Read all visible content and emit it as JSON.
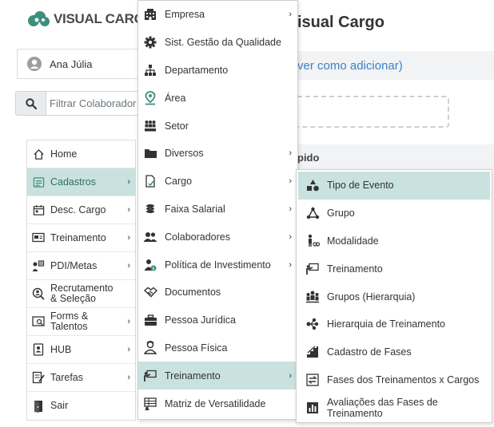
{
  "app": {
    "logo_text": "VISUAL CARGO",
    "page_title": "isual Cargo",
    "info_text": "ver como adicionar)",
    "section_text": "pido",
    "brand_color": "#3d8f7e",
    "active_color": "#c9e2df"
  },
  "user": {
    "name": "Ana Júlia"
  },
  "search": {
    "placeholder": "Filtrar Colaborador"
  },
  "sidebar": {
    "items": [
      {
        "label": "Home",
        "icon": "home-icon"
      },
      {
        "label": "Cadastros",
        "icon": "list-icon",
        "active": true
      },
      {
        "label": "Desc. Cargo",
        "icon": "calendar-icon"
      },
      {
        "label": "Treinamento",
        "icon": "presentation-icon"
      },
      {
        "label": "PDI/Metas",
        "icon": "goals-icon"
      },
      {
        "label": "Recrutamento & Seleção",
        "icon": "recruit-icon"
      },
      {
        "label": "Forms & Talentos",
        "icon": "form-icon"
      },
      {
        "label": "HUB",
        "icon": "hub-icon"
      },
      {
        "label": "Tarefas",
        "icon": "tasks-icon"
      },
      {
        "label": "Sair",
        "icon": "exit-icon"
      }
    ]
  },
  "menu_cadastros": {
    "items": [
      {
        "label": "Empresa",
        "icon": "building-icon"
      },
      {
        "label": "Sist. Gestão da Qualidade",
        "icon": "cog-icon"
      },
      {
        "label": "Departamento",
        "icon": "hierarchy-icon"
      },
      {
        "label": "Área",
        "icon": "map-pin-icon"
      },
      {
        "label": "Setor",
        "icon": "sector-icon"
      },
      {
        "label": "Diversos",
        "icon": "folder-icon"
      },
      {
        "label": "Cargo",
        "icon": "document-icon"
      },
      {
        "label": "Faixa Salarial",
        "icon": "coins-icon"
      },
      {
        "label": "Colaboradores",
        "icon": "users-icon"
      },
      {
        "label": "Política de Investimento",
        "icon": "investment-icon"
      },
      {
        "label": "Documentos",
        "icon": "handshake-icon"
      },
      {
        "label": "Pessoa Jurídica",
        "icon": "briefcase-icon"
      },
      {
        "label": "Pessoa Física",
        "icon": "person-icon"
      },
      {
        "label": "Treinamento",
        "icon": "presentation-icon",
        "active": true
      },
      {
        "label": "Matriz de Versatilidade",
        "icon": "matrix-icon"
      }
    ]
  },
  "menu_treinamento": {
    "items": [
      {
        "label": "Tipo de Evento",
        "icon": "shapes-icon",
        "active": true
      },
      {
        "label": "Grupo",
        "icon": "group-icon"
      },
      {
        "label": "Modalidade",
        "icon": "modality-icon"
      },
      {
        "label": "Treinamento",
        "icon": "presentation-icon"
      },
      {
        "label": "Grupos (Hierarquia)",
        "icon": "people-group-icon"
      },
      {
        "label": "Hierarquia de Treinamento",
        "icon": "tree-icon"
      },
      {
        "label": "Cadastro de Fases",
        "icon": "stairs-icon"
      },
      {
        "label": "Fases dos Treinamentos x Cargos",
        "icon": "swap-icon"
      },
      {
        "label": "Avaliações das Fases de Treinamento",
        "icon": "chart-icon"
      }
    ]
  }
}
